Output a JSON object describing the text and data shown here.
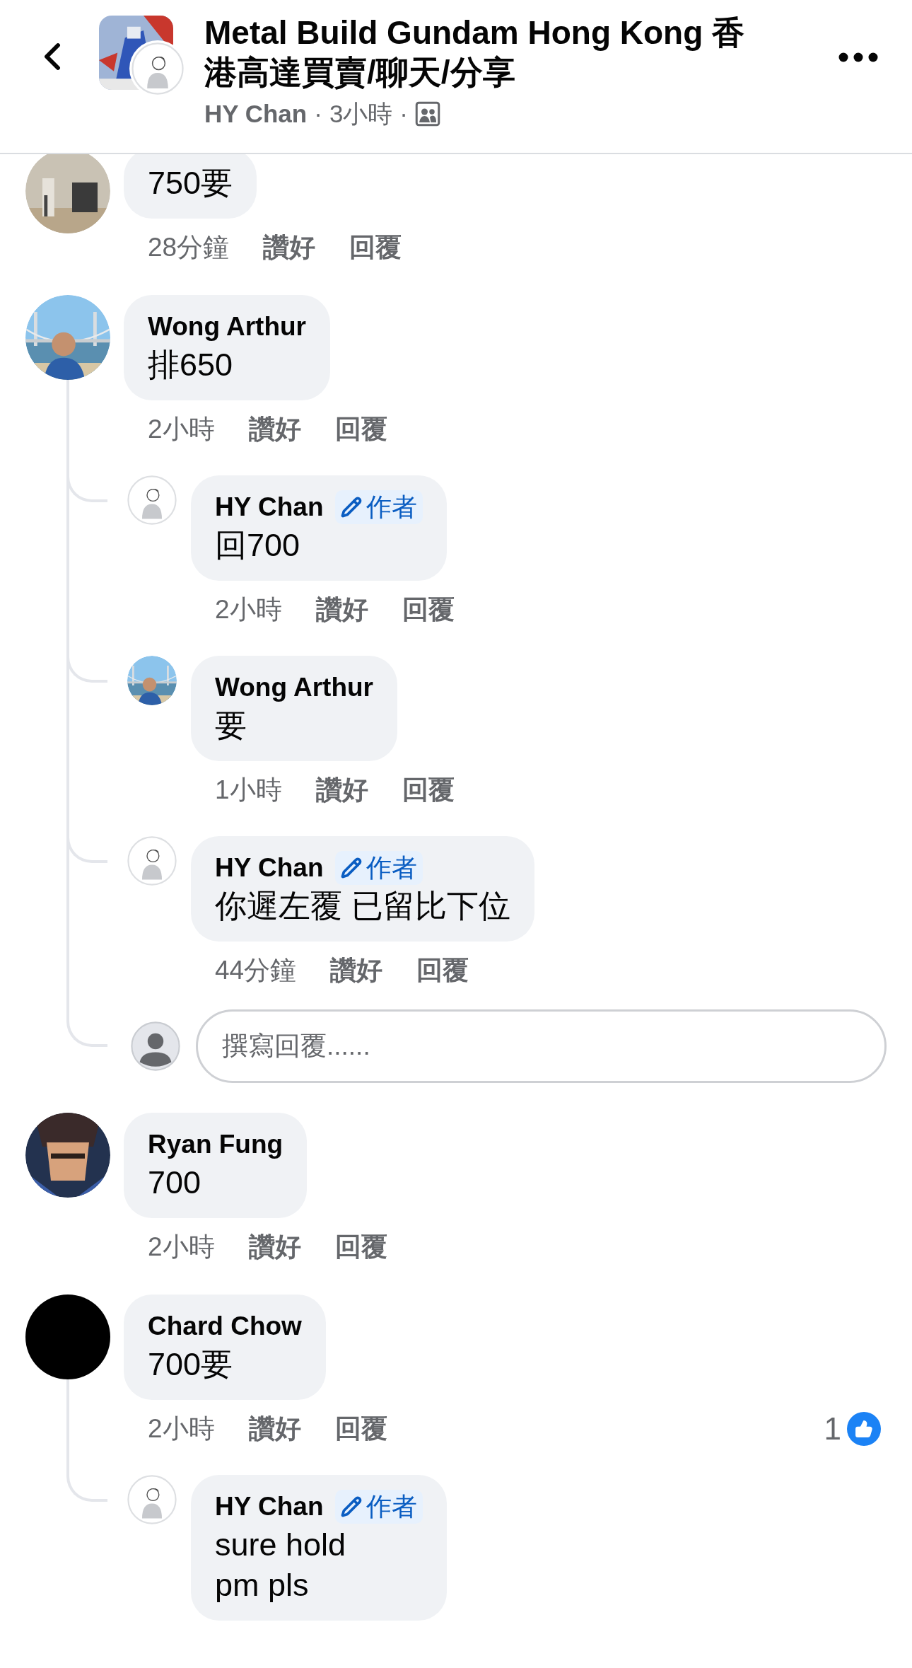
{
  "header": {
    "title": "Metal Build Gundam Hong Kong 香港高達買賣/聊天/分享",
    "author": "HY Chan",
    "dot_1": "·",
    "time": "3小時",
    "dot_2": "·"
  },
  "comments": [
    {
      "avatar": {
        "kind": "room"
      },
      "body": "750要",
      "time": "28分鐘",
      "like": "讚好",
      "reply": "回覆"
    },
    {
      "avatar": {
        "kind": "bridge"
      },
      "author": "Wong Arthur",
      "body": "排650",
      "time": "2小時",
      "like": "讚好",
      "reply": "回覆",
      "replies": [
        {
          "avatar": {
            "kind": "sketch"
          },
          "author": "HY Chan",
          "badge": "作者",
          "body": "回700",
          "time": "2小時",
          "like": "讚好",
          "reply": "回覆"
        },
        {
          "avatar": {
            "kind": "bridge"
          },
          "author": "Wong Arthur",
          "body": "要",
          "time": "1小時",
          "like": "讚好",
          "reply": "回覆"
        },
        {
          "avatar": {
            "kind": "sketch"
          },
          "author": "HY Chan",
          "badge": "作者",
          "body": "你遲左覆 已留比下位",
          "time": "44分鐘",
          "like": "讚好",
          "reply": "回覆"
        }
      ],
      "reply_field": {
        "placeholder": "撰寫回覆......"
      }
    },
    {
      "avatar": {
        "kind": "artwork"
      },
      "author": "Ryan Fung",
      "body": "700",
      "time": "2小時",
      "like": "讚好",
      "reply": "回覆"
    },
    {
      "avatar": {
        "kind": "black"
      },
      "author": "Chard Chow",
      "body": "700要",
      "time": "2小時",
      "like": "讚好",
      "reply": "回覆",
      "reaction_count": "1",
      "replies": [
        {
          "avatar": {
            "kind": "sketch"
          },
          "author": "HY Chan",
          "badge": "作者",
          "body": "sure hold\npm pls"
        }
      ]
    }
  ]
}
